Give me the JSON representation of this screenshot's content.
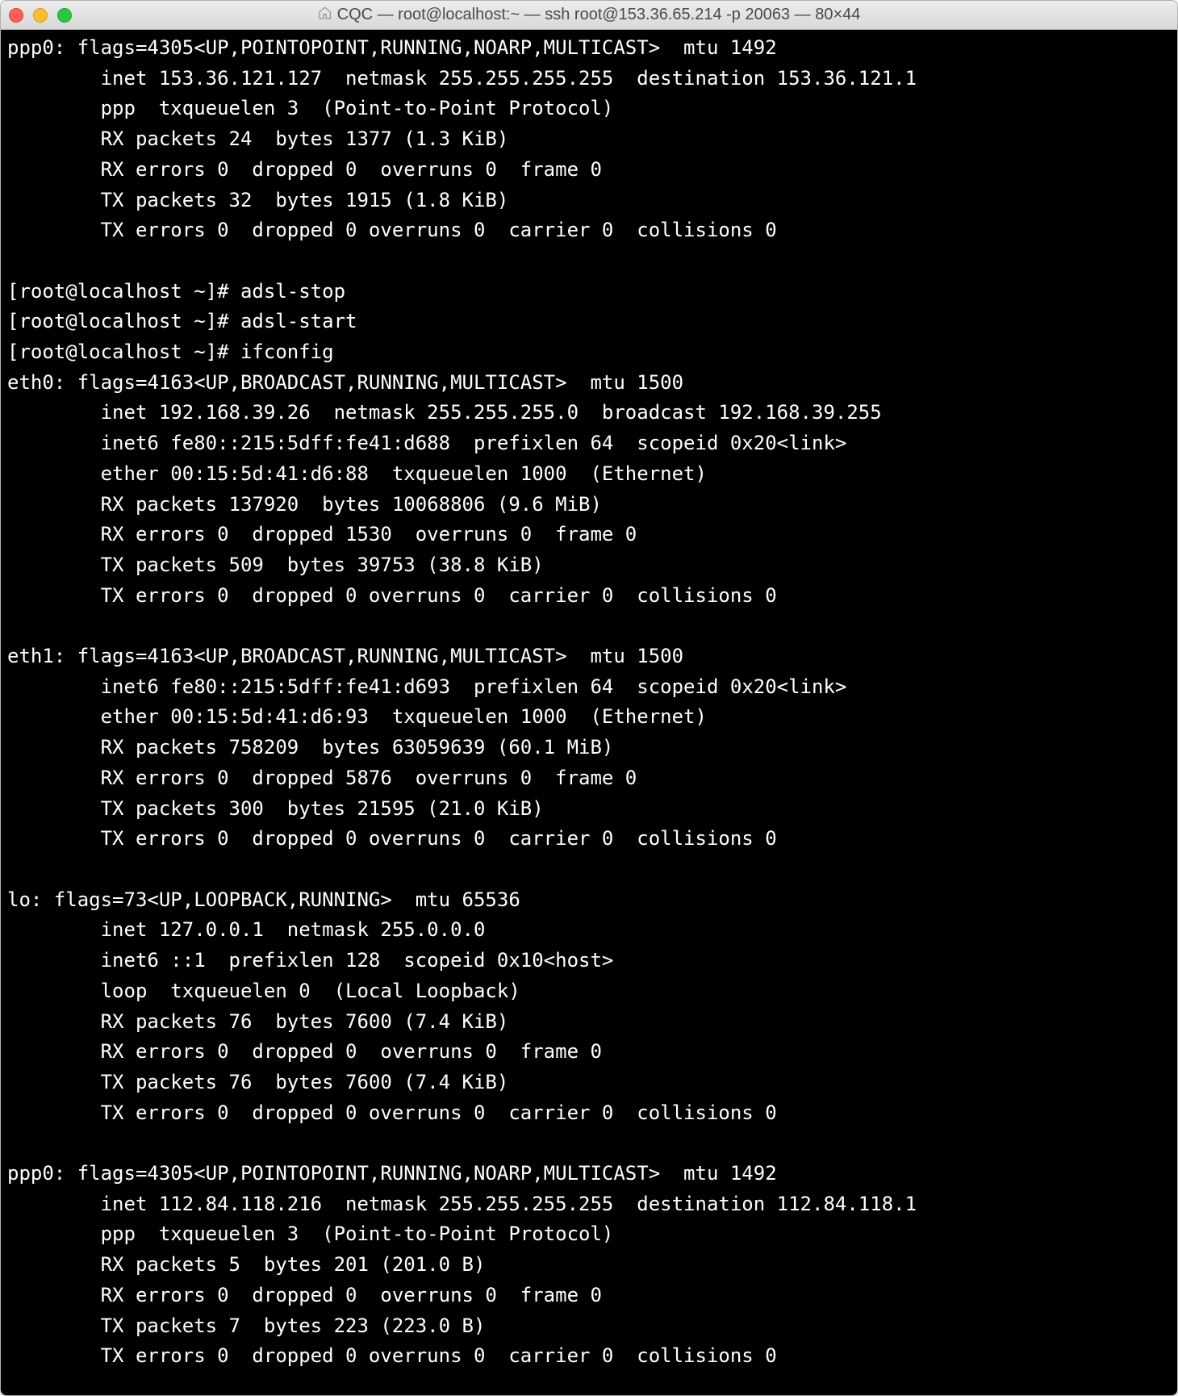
{
  "window": {
    "title": "CQC — root@localhost:~ — ssh root@153.36.65.214 -p 20063 — 80×44"
  },
  "prompts": {
    "adsl_stop": "[root@localhost ~]# adsl-stop",
    "adsl_start": "[root@localhost ~]# adsl-start",
    "ifconfig": "[root@localhost ~]# ifconfig"
  },
  "interfaces": {
    "ppp0_top": {
      "l1": "ppp0: flags=4305<UP,POINTOPOINT,RUNNING,NOARP,MULTICAST>  mtu 1492",
      "l2": "        inet 153.36.121.127  netmask 255.255.255.255  destination 153.36.121.1",
      "l3": "        ppp  txqueuelen 3  (Point-to-Point Protocol)",
      "l4": "        RX packets 24  bytes 1377 (1.3 KiB)",
      "l5": "        RX errors 0  dropped 0  overruns 0  frame 0",
      "l6": "        TX packets 32  bytes 1915 (1.8 KiB)",
      "l7": "        TX errors 0  dropped 0 overruns 0  carrier 0  collisions 0"
    },
    "eth0": {
      "l1": "eth0: flags=4163<UP,BROADCAST,RUNNING,MULTICAST>  mtu 1500",
      "l2": "        inet 192.168.39.26  netmask 255.255.255.0  broadcast 192.168.39.255",
      "l3": "        inet6 fe80::215:5dff:fe41:d688  prefixlen 64  scopeid 0x20<link>",
      "l4": "        ether 00:15:5d:41:d6:88  txqueuelen 1000  (Ethernet)",
      "l5": "        RX packets 137920  bytes 10068806 (9.6 MiB)",
      "l6": "        RX errors 0  dropped 1530  overruns 0  frame 0",
      "l7": "        TX packets 509  bytes 39753 (38.8 KiB)",
      "l8": "        TX errors 0  dropped 0 overruns 0  carrier 0  collisions 0"
    },
    "eth1": {
      "l1": "eth1: flags=4163<UP,BROADCAST,RUNNING,MULTICAST>  mtu 1500",
      "l2": "        inet6 fe80::215:5dff:fe41:d693  prefixlen 64  scopeid 0x20<link>",
      "l3": "        ether 00:15:5d:41:d6:93  txqueuelen 1000  (Ethernet)",
      "l4": "        RX packets 758209  bytes 63059639 (60.1 MiB)",
      "l5": "        RX errors 0  dropped 5876  overruns 0  frame 0",
      "l6": "        TX packets 300  bytes 21595 (21.0 KiB)",
      "l7": "        TX errors 0  dropped 0 overruns 0  carrier 0  collisions 0"
    },
    "lo": {
      "l1": "lo: flags=73<UP,LOOPBACK,RUNNING>  mtu 65536",
      "l2": "        inet 127.0.0.1  netmask 255.0.0.0",
      "l3": "        inet6 ::1  prefixlen 128  scopeid 0x10<host>",
      "l4": "        loop  txqueuelen 0  (Local Loopback)",
      "l5": "        RX packets 76  bytes 7600 (7.4 KiB)",
      "l6": "        RX errors 0  dropped 0  overruns 0  frame 0",
      "l7": "        TX packets 76  bytes 7600 (7.4 KiB)",
      "l8": "        TX errors 0  dropped 0 overruns 0  carrier 0  collisions 0"
    },
    "ppp0_bottom": {
      "l1": "ppp0: flags=4305<UP,POINTOPOINT,RUNNING,NOARP,MULTICAST>  mtu 1492",
      "l2": "        inet 112.84.118.216  netmask 255.255.255.255  destination 112.84.118.1",
      "l3": "        ppp  txqueuelen 3  (Point-to-Point Protocol)",
      "l4": "        RX packets 5  bytes 201 (201.0 B)",
      "l5": "        RX errors 0  dropped 0  overruns 0  frame 0",
      "l6": "        TX packets 7  bytes 223 (223.0 B)",
      "l7": "        TX errors 0  dropped 0 overruns 0  carrier 0  collisions 0"
    }
  }
}
